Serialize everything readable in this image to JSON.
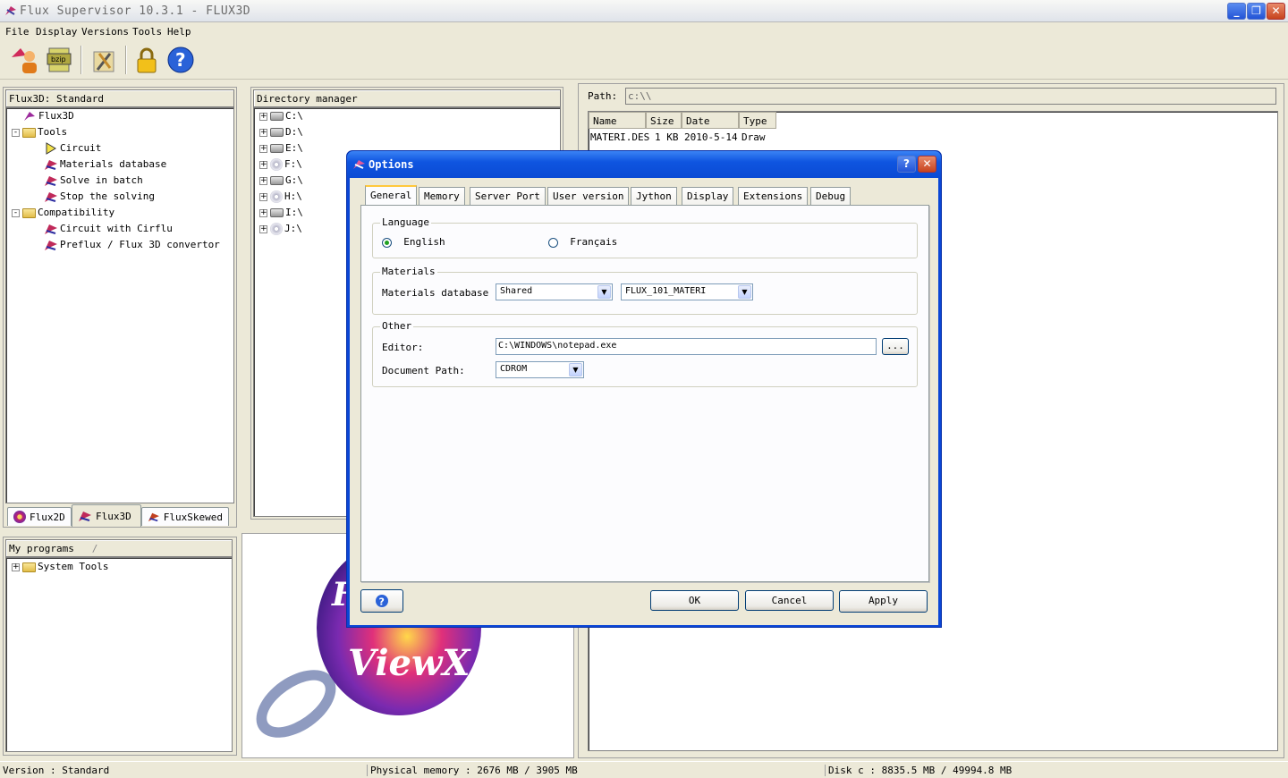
{
  "window": {
    "title": "Flux Supervisor 10.3.1 - FLUX3D",
    "min": "_",
    "max": "❐",
    "close": "✕"
  },
  "menu": [
    "File",
    "Display",
    "Versions",
    "Tools",
    "Help"
  ],
  "toolbar": {
    "icons": [
      "flux-user-icon",
      "bzip-archive-icon",
      "wrench-tools-icon",
      "padlock-icon",
      "help-icon"
    ],
    "help_glyph": "?"
  },
  "left_panel": {
    "header": "Flux3D: Standard",
    "tree": [
      {
        "label": "Flux3D",
        "level": 0
      },
      {
        "label": "Tools",
        "level": 0,
        "expander": "-"
      },
      {
        "label": "Circuit",
        "level": 1
      },
      {
        "label": "Materials database",
        "level": 1
      },
      {
        "label": "Solve in batch",
        "level": 1
      },
      {
        "label": "Stop the solving",
        "level": 1
      },
      {
        "label": "Compatibility",
        "level": 0,
        "expander": "-"
      },
      {
        "label": "Circuit with Cirflu",
        "level": 1
      },
      {
        "label": "Preflux / Flux 3D convertor",
        "level": 1
      }
    ],
    "tabs": [
      "Flux2D",
      "Flux3D",
      "FluxSkewed"
    ]
  },
  "programs": {
    "header": "My programs",
    "slash": "/",
    "items": [
      {
        "label": "System Tools",
        "expander": "+"
      }
    ]
  },
  "directory": {
    "header": "Directory manager",
    "drives": [
      "C:\\",
      "D:\\",
      "E:\\",
      "F:\\",
      "G:\\",
      "H:\\",
      "I:\\",
      "J:\\"
    ],
    "expander": "+"
  },
  "file_view": {
    "path_label": "Path:",
    "path_value": "c:\\\\",
    "columns": [
      "Name",
      "Size",
      "Date",
      "Type"
    ],
    "rows": [
      [
        "MATERI.DES",
        "1 KB",
        "2010-5-14",
        "Draw"
      ]
    ]
  },
  "logo": {
    "text": "ViewX",
    "letter": "F"
  },
  "dialog": {
    "title": "Options",
    "help_glyph": "?",
    "close_glyph": "✕",
    "tabs": [
      "General",
      "Memory",
      "Server Port",
      "User version",
      "Jython",
      "Display",
      "Extensions",
      "Debug"
    ],
    "language": {
      "legend": "Language",
      "options": [
        "English",
        "Français"
      ],
      "selected": "English"
    },
    "materials": {
      "legend": "Materials",
      "label": "Materials database",
      "combo1": "Shared",
      "combo2": "FLUX_101_MATERI"
    },
    "other": {
      "legend": "Other",
      "editor_label": "Editor:",
      "editor_value": "C:\\WINDOWS\\notepad.exe",
      "browse": "...",
      "docpath_label": "Document Path:",
      "docpath_value": "CDROM"
    },
    "buttons": {
      "ok": "OK",
      "cancel": "Cancel",
      "apply": "Apply"
    },
    "arrow": "▼"
  },
  "status": {
    "version": "Version : Standard",
    "memory": "Physical memory : 2676 MB / 3905 MB",
    "disk": "Disk c : 8835.5 MB / 49994.8 MB"
  }
}
